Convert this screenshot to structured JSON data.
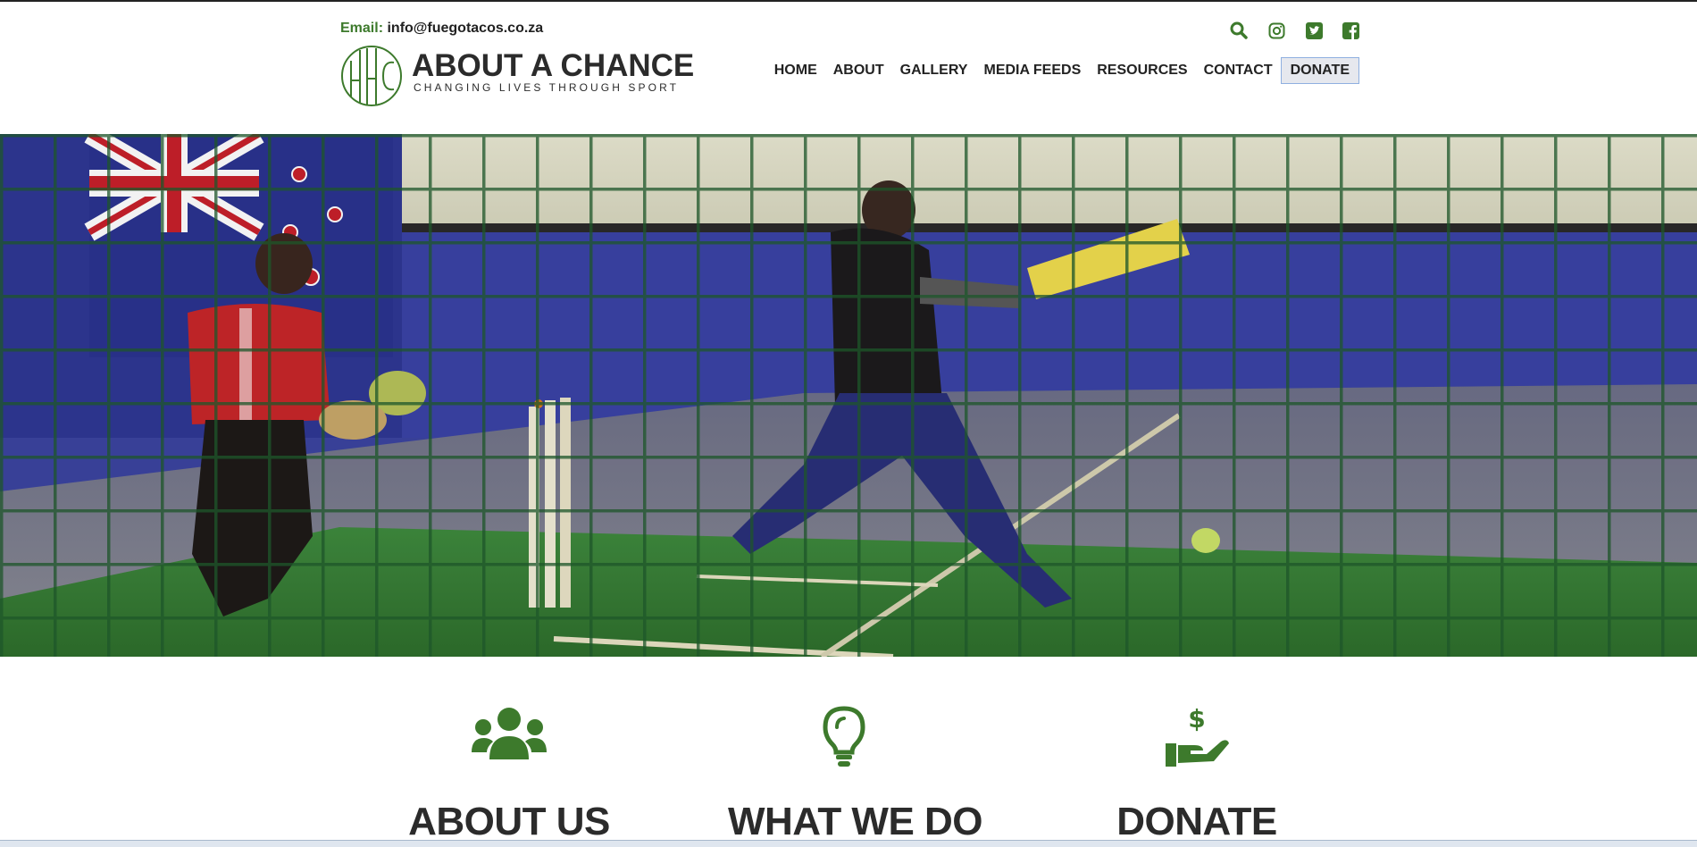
{
  "header": {
    "email_label": "Email:",
    "email_value": "info@fuegotacos.co.za",
    "logo_title": "ABOUT A CHANCE",
    "logo_tagline": "CHANGING LIVES THROUGH SPORT",
    "social_icons": [
      "search-icon",
      "instagram-icon",
      "twitter-icon",
      "facebook-icon"
    ],
    "accent_color": "#3d7a2c"
  },
  "nav": {
    "items": [
      "HOME",
      "ABOUT",
      "GALLERY",
      "MEDIA FEEDS",
      "RESOURCES",
      "CONTACT",
      "DONATE"
    ]
  },
  "hero": {
    "image": "indoor cricket nets photo with batsman and wicket keeper"
  },
  "features": [
    {
      "icon": "users-icon",
      "title": "ABOUT US"
    },
    {
      "icon": "lightbulb-icon",
      "title": "WHAT WE DO"
    },
    {
      "icon": "donate-hand-icon",
      "title": "DONATE"
    }
  ]
}
